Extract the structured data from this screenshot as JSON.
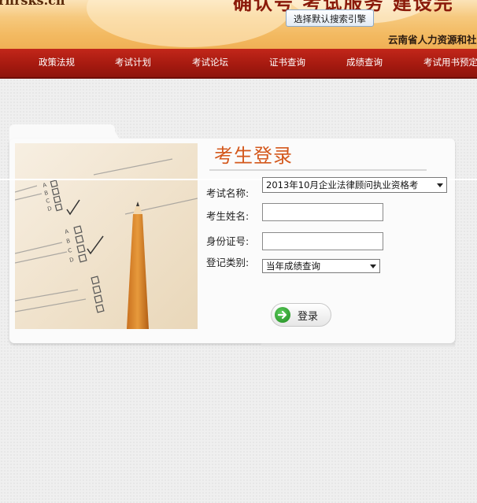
{
  "header": {
    "site_url": "rnrsks.cn",
    "slogan": "确认号 考试服务  建设完",
    "engine_button": "选择默认搜索引擎",
    "org_name": "云南省人力资源和社"
  },
  "nav": {
    "items": [
      {
        "label": "政策法规"
      },
      {
        "label": "考试计划"
      },
      {
        "label": "考试论坛"
      },
      {
        "label": "证书查询"
      },
      {
        "label": "成绩查询"
      },
      {
        "label": "考试用书预定"
      }
    ]
  },
  "login": {
    "title": "考生登录",
    "exam_name_label": "考试名称:",
    "exam_name_value": "2013年10月企业法律顾问执业资格考",
    "name_label": "考生姓名:",
    "name_value": "",
    "id_label": "身份证号:",
    "id_value": "",
    "type_label": "登记类别:",
    "type_value": "当年成绩查询",
    "submit_label": "登录"
  },
  "colors": {
    "nav_bg": "#a61a10",
    "title": "#d4581c",
    "go_icon": "#1e8a1e"
  }
}
